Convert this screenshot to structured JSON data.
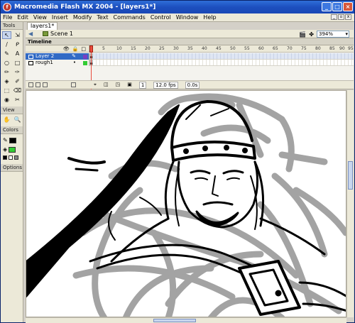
{
  "window": {
    "title": "Macromedia Flash MX 2004 - [layers1*]",
    "app_icon": "flash-app-icon",
    "buttons": [
      "_",
      "□",
      "×"
    ]
  },
  "menu": [
    "File",
    "Edit",
    "View",
    "Insert",
    "Modify",
    "Text",
    "Commands",
    "Control",
    "Window",
    "Help"
  ],
  "tools": {
    "title": "Tools",
    "items": [
      "↖",
      "⇲",
      "∕",
      "ᑭ",
      "✎",
      "A",
      "○",
      "□",
      "✏",
      "✑",
      "◈",
      "✐",
      "⬚",
      "⌫",
      "◉",
      "✂"
    ],
    "view_title": "View",
    "view_items": [
      "✋",
      "🔍"
    ],
    "colors_title": "Colors",
    "options_title": "Options",
    "stroke_color": "#000000",
    "fill_color": "#33cc33"
  },
  "document": {
    "tab_label": "layers1*",
    "scene_label": "Scene 1",
    "zoom": "394%"
  },
  "timeline": {
    "header": "Timeline",
    "ruler_ticks": [
      "5",
      "10",
      "15",
      "20",
      "25",
      "30",
      "35",
      "40",
      "45",
      "50",
      "55",
      "60",
      "65",
      "70",
      "75",
      "80",
      "85",
      "90",
      "95"
    ],
    "column_icons": [
      "👁",
      "🔒",
      "□"
    ],
    "layers": [
      {
        "name": "Layer 2",
        "selected": true,
        "outline_color": "#7a3fc2"
      },
      {
        "name": "rough1",
        "selected": false,
        "outline_color": "#33cc33"
      }
    ],
    "current_frame": "1",
    "fps": "12.0 fps",
    "time": "0.0s"
  },
  "colors": {
    "accent": "#316ac5",
    "playhead": "#e84c3d",
    "stage_bg": "#ffffff"
  }
}
